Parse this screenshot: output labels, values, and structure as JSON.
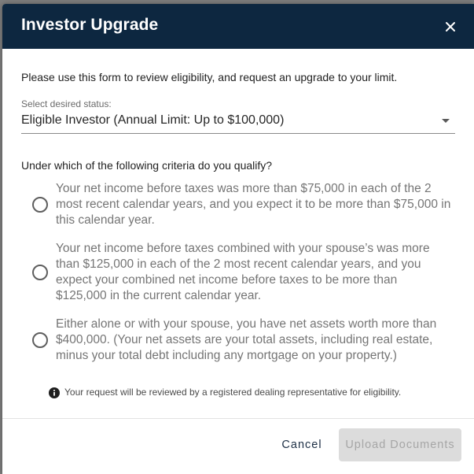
{
  "dialog": {
    "title": "Investor Upgrade",
    "close_label": "×",
    "intro": "Please use this form to review eligibility, and request an upgrade to your limit.",
    "status_select": {
      "label": "Select desired status:",
      "value": "Eligible Investor (Annual Limit: Up to $100,000)"
    },
    "criteria_question": "Under which of the following criteria do you qualify?",
    "criteria": [
      {
        "text": "Your net income before taxes was more than $75,000 in each of the 2\nmost recent calendar years, and you expect it to be more than $75,000 in\nthis calendar year.",
        "selected": false
      },
      {
        "text": "Your net income before taxes combined with your spouse’s was more\nthan $125,000 in each of the 2 most recent calendar years, and you\nexpect your combined net income before taxes to be more than\n$125,000 in the current calendar year.",
        "selected": false
      },
      {
        "text": "Either alone or with your spouse, you have net assets worth more than\n$400,000. (Your net assets are your total assets, including real estate,\nminus your total debt including any mortgage on your property.)",
        "selected": false
      }
    ],
    "note": "Your request will be reviewed by a registered dealing representative for eligibility.",
    "actions": {
      "cancel_label": "Cancel",
      "upload_label": "Upload Documents",
      "upload_disabled": true
    }
  },
  "colors": {
    "header_bg": "#0d2740",
    "disabled_button_bg": "#dcdcdc",
    "cancel_text": "#1d2f45"
  },
  "icons": {
    "close": "close-icon",
    "dropdown": "caret-down-icon",
    "info": "info-icon"
  }
}
